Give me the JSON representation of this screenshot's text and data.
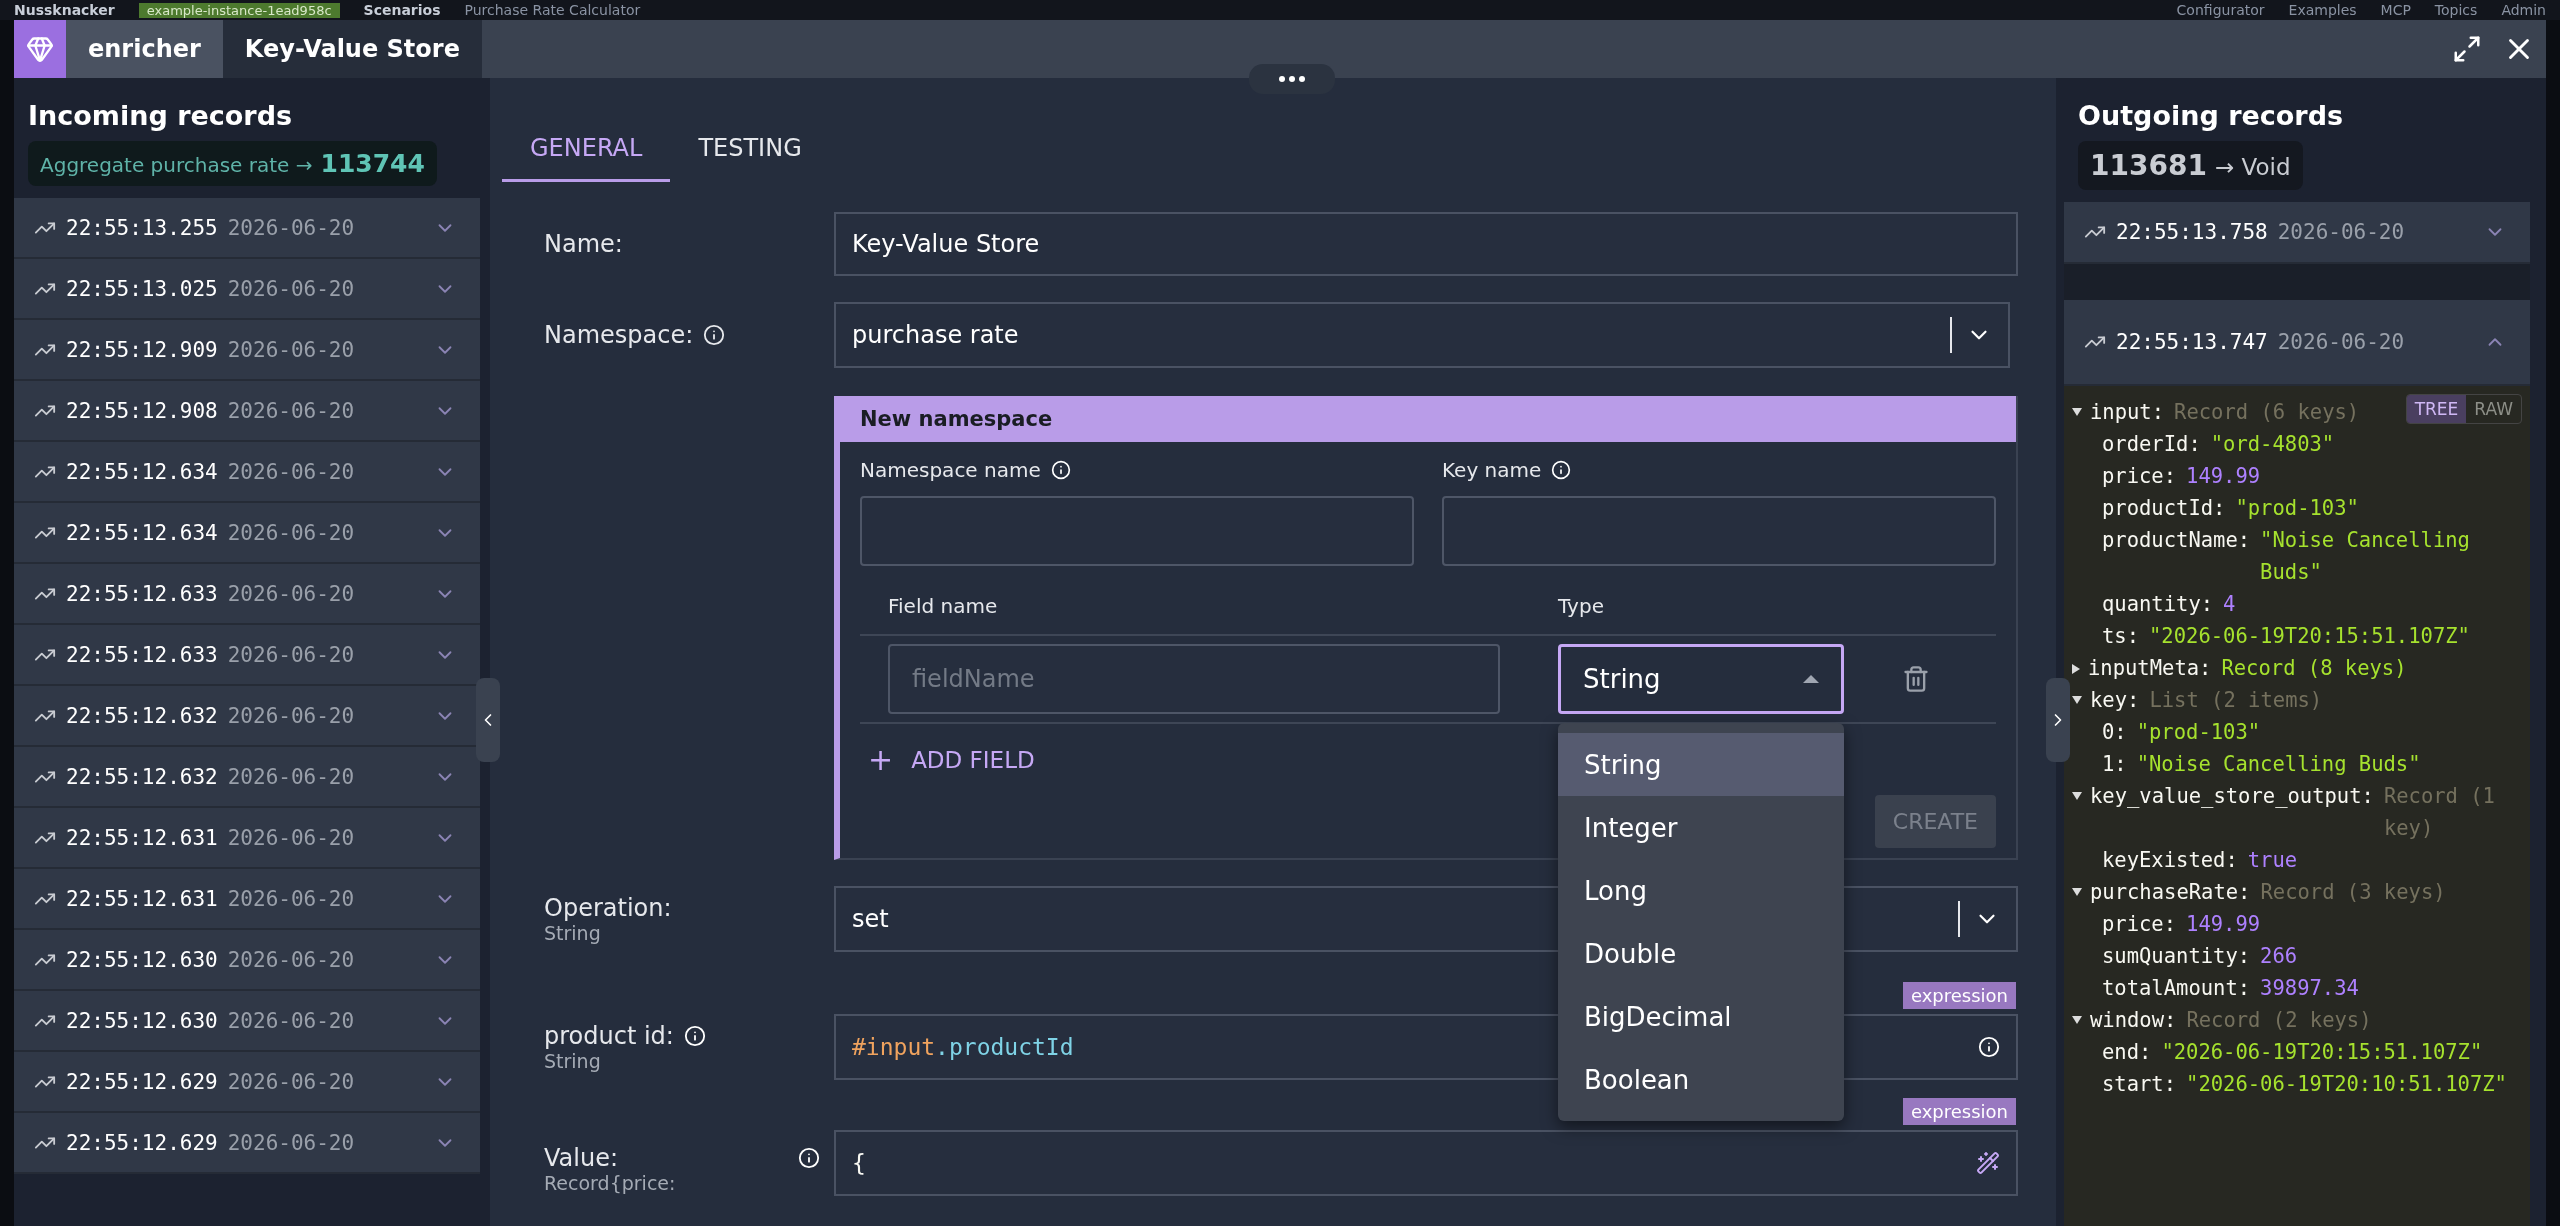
{
  "app_bar": {
    "logo": "Nussknacker",
    "instance": "example-instance-1ead958c",
    "breadcrumbs": [
      "Scenarios",
      "Purchase Rate Calculator"
    ],
    "menu": [
      "Configurator",
      "Examples",
      "MCP",
      "Topics",
      "Admin"
    ]
  },
  "window": {
    "type": "enricher",
    "title": "Key-Value Store"
  },
  "incoming": {
    "title": "Incoming records",
    "summary": {
      "label": "Aggregate purchase rate →",
      "count": "113744"
    },
    "records": [
      {
        "time": "22:55:13.255",
        "date": "2026-06-20"
      },
      {
        "time": "22:55:13.025",
        "date": "2026-06-20"
      },
      {
        "time": "22:55:12.909",
        "date": "2026-06-20"
      },
      {
        "time": "22:55:12.908",
        "date": "2026-06-20"
      },
      {
        "time": "22:55:12.634",
        "date": "2026-06-20"
      },
      {
        "time": "22:55:12.634",
        "date": "2026-06-20"
      },
      {
        "time": "22:55:12.633",
        "date": "2026-06-20"
      },
      {
        "time": "22:55:12.633",
        "date": "2026-06-20"
      },
      {
        "time": "22:55:12.632",
        "date": "2026-06-20"
      },
      {
        "time": "22:55:12.632",
        "date": "2026-06-20"
      },
      {
        "time": "22:55:12.631",
        "date": "2026-06-20"
      },
      {
        "time": "22:55:12.631",
        "date": "2026-06-20"
      },
      {
        "time": "22:55:12.630",
        "date": "2026-06-20"
      },
      {
        "time": "22:55:12.630",
        "date": "2026-06-20"
      },
      {
        "time": "22:55:12.629",
        "date": "2026-06-20"
      },
      {
        "time": "22:55:12.629",
        "date": "2026-06-20"
      }
    ]
  },
  "tabs": [
    {
      "label": "GENERAL",
      "selected": true
    },
    {
      "label": "TESTING",
      "selected": false
    }
  ],
  "form": {
    "name": {
      "label": "Name:",
      "value": "Key-Value Store"
    },
    "namespace": {
      "label": "Namespace:",
      "value": "purchase rate"
    },
    "new_namespace": {
      "title": "New namespace",
      "namespace_name_label": "Namespace name",
      "key_name_label": "Key name",
      "field_name_header": "Field name",
      "type_header": "Type",
      "fields": [
        {
          "placeholder": "fieldName",
          "type": "String"
        }
      ],
      "add_field": "+",
      "add_field_label": "ADD FIELD",
      "create": {
        "label": "CREATE",
        "disabled": true
      },
      "type_menu": {
        "open": true,
        "options": [
          {
            "label": "String",
            "selected": true
          },
          {
            "label": "Integer",
            "selected": false
          },
          {
            "label": "Long",
            "selected": false
          },
          {
            "label": "Double",
            "selected": false
          },
          {
            "label": "BigDecimal",
            "selected": false
          },
          {
            "label": "Boolean",
            "selected": false
          }
        ]
      }
    },
    "operation": {
      "label": "Operation:",
      "type": "String",
      "value": "set"
    },
    "product_id": {
      "label": "product id:",
      "type": "String",
      "badge": "expression",
      "value_prefix": "#input",
      "value_suffix": ".productId"
    },
    "value": {
      "label": "Value:",
      "type": "Record{price:",
      "badge": "expression",
      "value": "{"
    }
  },
  "outgoing": {
    "title": "Outgoing records",
    "summary": {
      "count": "113681",
      "label": "→ Void"
    },
    "records": [
      {
        "time": "22:55:13.758",
        "date": "2026-06-20",
        "expanded": false
      },
      {
        "time": "22:55:13.747",
        "date": "2026-06-20",
        "expanded": true
      }
    ],
    "view_toggle": [
      {
        "label": "TREE",
        "selected": true
      },
      {
        "label": "RAW",
        "selected": false
      }
    ],
    "tree": [
      {
        "key": "input:",
        "value": "Record (6 keys)",
        "kind": "type",
        "expanded": true,
        "children": [
          {
            "key": "orderId:",
            "value": "\"ord-4803\"",
            "kind": "string"
          },
          {
            "key": "price:",
            "value": "149.99",
            "kind": "number"
          },
          {
            "key": "productId:",
            "value": "\"prod-103\"",
            "kind": "string"
          },
          {
            "key": "productName:",
            "value": "\"Noise Cancelling Buds\"",
            "kind": "string"
          },
          {
            "key": "quantity:",
            "value": "4",
            "kind": "number"
          },
          {
            "key": "ts:",
            "value": "\"2026-06-19T20:15:51.107Z\"",
            "kind": "string"
          }
        ]
      },
      {
        "key": "inputMeta:",
        "value": "Record (8 keys)",
        "kind": "string",
        "expanded": false
      },
      {
        "key": "key:",
        "value": "List (2 items)",
        "kind": "type",
        "expanded": true,
        "children": [
          {
            "key": "0:",
            "value": "\"prod-103\"",
            "kind": "string"
          },
          {
            "key": "1:",
            "value": "\"Noise Cancelling Buds\"",
            "kind": "string"
          }
        ]
      },
      {
        "key": "key_value_store_output:",
        "value": "Record (1 key)",
        "kind": "type",
        "expanded": true,
        "children": [
          {
            "key": "keyExisted:",
            "value": "true",
            "kind": "number"
          }
        ]
      },
      {
        "key": "purchaseRate:",
        "value": "Record (3 keys)",
        "kind": "type",
        "expanded": true,
        "children": [
          {
            "key": "price:",
            "value": "149.99",
            "kind": "number"
          },
          {
            "key": "sumQuantity:",
            "value": "266",
            "kind": "number"
          },
          {
            "key": "totalAmount:",
            "value": "39897.34",
            "kind": "number"
          }
        ]
      },
      {
        "key": "window:",
        "value": "Record (2 keys)",
        "kind": "type",
        "expanded": true,
        "children": [
          {
            "key": "end:",
            "value": "\"2026-06-19T20:15:51.107Z\"",
            "kind": "string"
          },
          {
            "key": "start:",
            "value": "\"2026-06-19T20:10:51.107Z\"",
            "kind": "string"
          }
        ]
      }
    ]
  }
}
